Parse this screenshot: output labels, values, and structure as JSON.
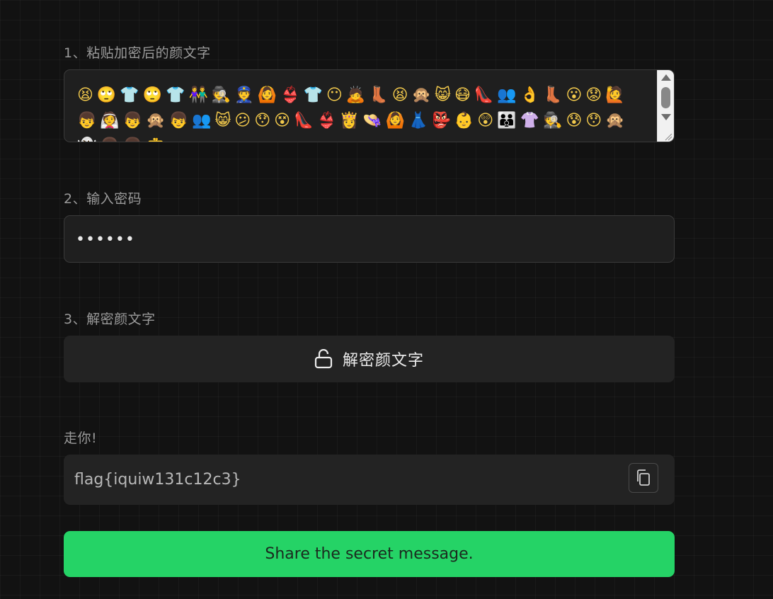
{
  "steps": {
    "paste_label": "1、粘贴加密后的颜文字",
    "password_label": "2、输入密码",
    "decrypt_label": "3、解密颜文字",
    "result_label": "走你!"
  },
  "emoji_input": {
    "value": "😫🙄👕🙄👕👫🕵👮🙆👙👕😶🙇👢😫🙊😸😷👠👥👌👢😮😟🙋👦👰👦🙊👦👥😸😕😯😵👠👙👸👒🙆👗👺👶😲👪👚🕵😰😯🙊👻👩👦👛"
  },
  "password": {
    "masked_value": "••••••"
  },
  "decrypt_button": {
    "label": "解密颜文字",
    "icon": "unlock-icon"
  },
  "result": {
    "value": "flag{iquiw131c12c3}",
    "copy_icon": "copy-icon"
  },
  "share_button": {
    "label": "Share the secret message."
  },
  "colors": {
    "background": "#121212",
    "field": "#1f1f1f",
    "accent_green": "#25d366"
  }
}
